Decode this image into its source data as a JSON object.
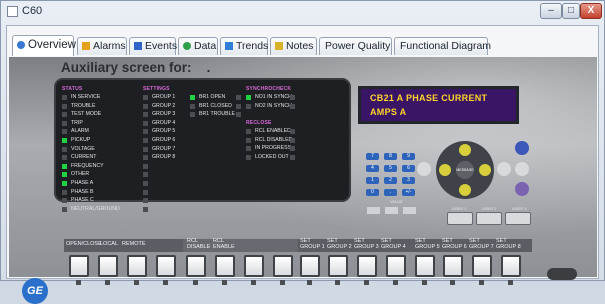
{
  "window": {
    "title": "C60",
    "buttons": {
      "minimize": "–",
      "maximize": "□",
      "close": "X"
    }
  },
  "tabs": [
    {
      "label": "Overview",
      "icon_color": "#3a78d4"
    },
    {
      "label": "Alarms",
      "icon_color": "#e4a21c"
    },
    {
      "label": "Events",
      "icon_color": "#2f64c8"
    },
    {
      "label": "Data",
      "icon_color": "#31a04b"
    },
    {
      "label": "Trends",
      "icon_color": "#2f7fd6"
    },
    {
      "label": "Notes",
      "icon_color": "#d8b32a"
    },
    {
      "label": "Power Quality",
      "icon_color": ""
    },
    {
      "label": "Functional Diagram",
      "icon_color": ""
    }
  ],
  "aux_screen": {
    "label": "Auxiliary screen for:",
    "value": "."
  },
  "status": {
    "header": "STATUS",
    "items": [
      {
        "label": "IN SERVICE",
        "on": false
      },
      {
        "label": "TROUBLE",
        "on": false
      },
      {
        "label": "TEST MODE",
        "on": false
      },
      {
        "label": "TRIP",
        "on": false
      },
      {
        "label": "ALARM",
        "on": false
      },
      {
        "label": "PICKUP",
        "on": true
      },
      {
        "label": "VOLTAGE",
        "on": false
      },
      {
        "label": "CURRENT",
        "on": false
      },
      {
        "label": "FREQUENCY",
        "on": true
      },
      {
        "label": "OTHER",
        "on": true
      },
      {
        "label": "PHASE A",
        "on": true
      },
      {
        "label": "PHASE B",
        "on": false
      },
      {
        "label": "PHASE C",
        "on": false
      },
      {
        "label": "NEUTRAL/GROUND",
        "on": false
      }
    ]
  },
  "settings": {
    "header": "SETTINGS",
    "items": [
      {
        "label": "GROUP 1",
        "on": false
      },
      {
        "label": "GROUP 2",
        "on": false
      },
      {
        "label": "GROUP 3",
        "on": false
      },
      {
        "label": "GROUP 4",
        "on": false
      },
      {
        "label": "GROUP 5",
        "on": false
      },
      {
        "label": "GROUP 6",
        "on": false
      },
      {
        "label": "GROUP 7",
        "on": false
      },
      {
        "label": "GROUP 8",
        "on": false
      }
    ]
  },
  "breaker": {
    "items": [
      {
        "label": "BR1 OPEN",
        "on": true
      },
      {
        "label": "BR1 CLOSED",
        "on": false
      },
      {
        "label": "BR1 TROUBLE",
        "on": false
      }
    ]
  },
  "synchrocheck": {
    "header": "SYNCHROCHECK",
    "items": [
      {
        "label": "NO1 IN SYNCH",
        "on": true
      },
      {
        "label": "NO2 IN SYNCH",
        "on": false
      }
    ]
  },
  "reclose": {
    "header": "RECLOSE",
    "items": [
      {
        "label": "RCL ENABLED",
        "on": false
      },
      {
        "label": "RCL DISABLED",
        "on": false
      },
      {
        "label": "IN PROGRESS",
        "on": false
      },
      {
        "label": "LOCKED OUT",
        "on": false
      }
    ]
  },
  "lcd": {
    "line1": "CB21 A PHASE CURRENT",
    "line2": "AMPS   A"
  },
  "keypad": [
    "7",
    "8",
    "9",
    "4",
    "5",
    "6",
    "1",
    "2",
    "3",
    "0",
    ".",
    "+/-"
  ],
  "nav": {
    "center": "MESSAGE",
    "menu": "MENU",
    "help": "HELP",
    "escape": "ESCAPE",
    "enter": "ENTER"
  },
  "value_label": "VALUE",
  "user_buttons": [
    "USER 1",
    "USER 2",
    "USER 3"
  ],
  "strip_labels": [
    "OPEN/CLOSE",
    "LOCAL",
    "REMOTE",
    "RCL DISABLE",
    "RCL ENABLE",
    "SET GROUP 1",
    "SET GROUP 2",
    "SET GROUP 3",
    "SET GROUP 4",
    "SET GROUP 5",
    "SET GROUP 6",
    "SET GROUP 7",
    "SET GROUP 8"
  ],
  "logo": "GE"
}
